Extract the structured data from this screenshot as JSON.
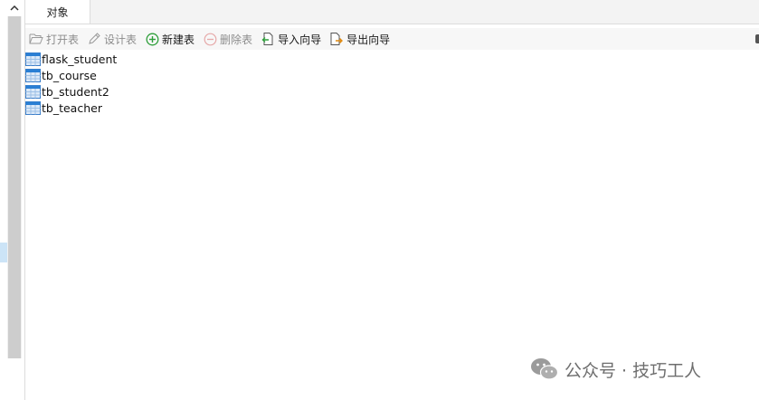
{
  "tabs": [
    {
      "label": "对象",
      "active": true
    }
  ],
  "toolbar": {
    "open_table": {
      "label": "打开表",
      "icon": "folder-open-icon",
      "enabled": false
    },
    "design_table": {
      "label": "设计表",
      "icon": "pencil-icon",
      "enabled": false
    },
    "new_table": {
      "label": "新建表",
      "icon": "plus-circle-icon",
      "enabled": true
    },
    "delete_table": {
      "label": "删除表",
      "icon": "minus-circle-icon",
      "enabled": false
    },
    "import_wizard": {
      "label": "导入向导",
      "icon": "import-icon",
      "enabled": true
    },
    "export_wizard": {
      "label": "导出向导",
      "icon": "export-icon",
      "enabled": true
    }
  },
  "objects": [
    {
      "name": "flask_student",
      "icon": "table-icon"
    },
    {
      "name": "tb_course",
      "icon": "table-icon"
    },
    {
      "name": "tb_student2",
      "icon": "table-icon"
    },
    {
      "name": "tb_teacher",
      "icon": "table-icon"
    }
  ],
  "watermark": {
    "text": "公众号 · 技巧工人",
    "icon": "wechat-icon"
  },
  "colors": {
    "new_green": "#2e9e3a",
    "table_blue": "#2a7fd4",
    "disabled_gray": "#8c8c8c"
  }
}
